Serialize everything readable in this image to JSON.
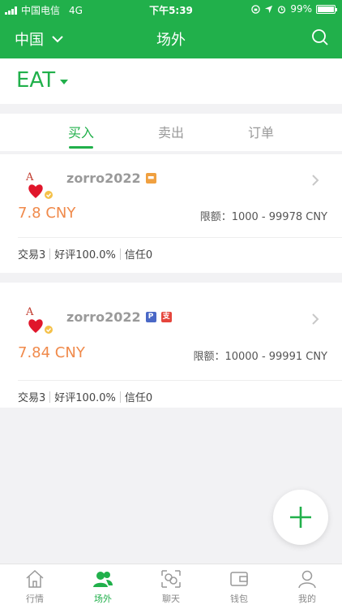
{
  "status_bar": {
    "carrier": "中国电信",
    "network": "4G",
    "time": "下午5:39",
    "battery": "99%",
    "battery_level": 0.99
  },
  "nav": {
    "region": "中国",
    "title": "场外"
  },
  "coin": {
    "symbol": "EAT"
  },
  "tabs": [
    {
      "label": "买入",
      "active": true
    },
    {
      "label": "卖出",
      "active": false
    },
    {
      "label": "订单",
      "active": false
    }
  ],
  "listings": [
    {
      "username": "zorro2022",
      "payment_methods": [
        "bank-card-icon"
      ],
      "price": "7.8 CNY",
      "limit_label": "限额：",
      "limit_range": "1000 - 99978 CNY",
      "trades": "交易3",
      "rating": "好评100.0%",
      "trust": "信任0"
    },
    {
      "username": "zorro2022",
      "payment_methods": [
        "paypal-icon",
        "alipay-red-icon"
      ],
      "price": "7.84 CNY",
      "limit_label": "限额：",
      "limit_range": "10000 - 99991 CNY",
      "trades": "交易3",
      "rating": "好评100.0%",
      "trust": "信任0"
    }
  ],
  "bottom_tabs": [
    {
      "label": "行情",
      "icon": "home-icon",
      "active": false
    },
    {
      "label": "场外",
      "icon": "users-icon",
      "active": true
    },
    {
      "label": "聊天",
      "icon": "chat-icon",
      "active": false
    },
    {
      "label": "钱包",
      "icon": "wallet-icon",
      "active": false
    },
    {
      "label": "我的",
      "icon": "profile-icon",
      "active": false
    }
  ],
  "colors": {
    "brand": "#21b04b",
    "price": "#f08a4b"
  }
}
